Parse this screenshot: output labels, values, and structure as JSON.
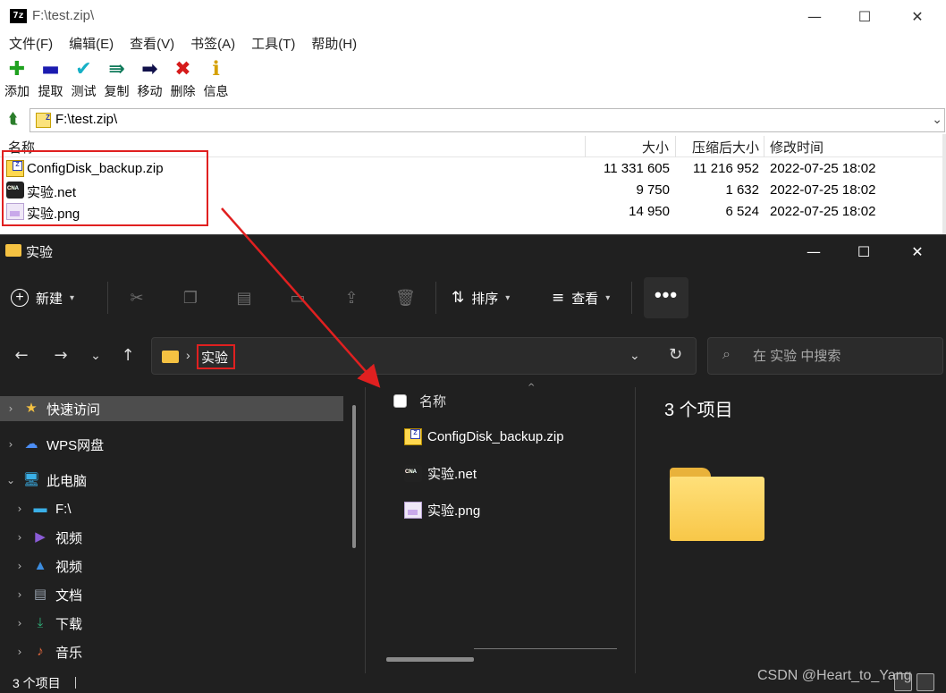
{
  "zip": {
    "app_icon": "7z",
    "title": "F:\\test.zip\\",
    "menu": [
      "文件(F)",
      "编辑(E)",
      "查看(V)",
      "书签(A)",
      "工具(T)",
      "帮助(H)"
    ],
    "tools": [
      {
        "label": "添加",
        "icon": "plus-icon",
        "color": "#1fa11f"
      },
      {
        "label": "提取",
        "icon": "minus-icon",
        "color": "#1b1bb0"
      },
      {
        "label": "测试",
        "icon": "checkmark-icon",
        "color": "#16b0c6"
      },
      {
        "label": "复制",
        "icon": "double-arrow-icon",
        "color": "#0f7a5a"
      },
      {
        "label": "移动",
        "icon": "arrow-right-icon",
        "color": "#10104a"
      },
      {
        "label": "删除",
        "icon": "x-icon",
        "color": "#d61b1b"
      },
      {
        "label": "信息",
        "icon": "info-icon",
        "color": "#d5a000"
      }
    ],
    "address": "F:\\test.zip\\",
    "columns": {
      "name": "名称",
      "size": "大小",
      "packed": "压缩后大小",
      "modified": "修改时间"
    },
    "files": [
      {
        "name": "ConfigDisk_backup.zip",
        "size": "11 331 605",
        "packed": "11 216 952",
        "modified": "2022-07-25 18:02",
        "icon": "zip-file-icon"
      },
      {
        "name": "实验.net",
        "size": "9 750",
        "packed": "1 632",
        "modified": "2022-07-25 18:02",
        "icon": "net-file-icon"
      },
      {
        "name": "实验.png",
        "size": "14 950",
        "packed": "6 524",
        "modified": "2022-07-25 18:02",
        "icon": "png-file-icon"
      }
    ]
  },
  "explorer": {
    "title": "实验",
    "cmd": {
      "new": "新建",
      "sort": "排序",
      "view": "查看",
      "more": "•••"
    },
    "breadcrumb": "实验",
    "search_placeholder": "在 实验 中搜索",
    "nav": [
      {
        "label": "快速访问",
        "icon": "star-icon",
        "expand": "›",
        "color": "#f5c242"
      },
      {
        "label": "WPS网盘",
        "icon": "cloud-icon",
        "expand": "›",
        "color": "#4c8ef5"
      },
      {
        "label": "此电脑",
        "icon": "computer-icon",
        "expand": "⌄",
        "color": "#3ab0e8"
      },
      {
        "label": "F:\\",
        "icon": "drive-icon",
        "expand": "›",
        "color": "#3ab0e8"
      },
      {
        "label": "视频",
        "icon": "video-icon",
        "expand": "›",
        "color": "#8a5cd6"
      },
      {
        "label": "视频",
        "icon": "picture-icon",
        "expand": "›",
        "color": "#3c8de0"
      },
      {
        "label": "文档",
        "icon": "document-icon",
        "expand": "›",
        "color": "#9aa4b1"
      },
      {
        "label": "下载",
        "icon": "download-icon",
        "expand": "›",
        "color": "#2fb27a"
      },
      {
        "label": "音乐",
        "icon": "music-icon",
        "expand": "›",
        "color": "#e0663c"
      }
    ],
    "list_header": "名称",
    "files": [
      {
        "name": "ConfigDisk_backup.zip",
        "icon": "zip-file-icon"
      },
      {
        "name": "实验.net",
        "icon": "net-file-icon"
      },
      {
        "name": "实验.png",
        "icon": "png-file-icon"
      }
    ],
    "preview_count": "3 个项目",
    "status": "3 个项目"
  },
  "watermark": "CSDN @Heart_to_Yang"
}
